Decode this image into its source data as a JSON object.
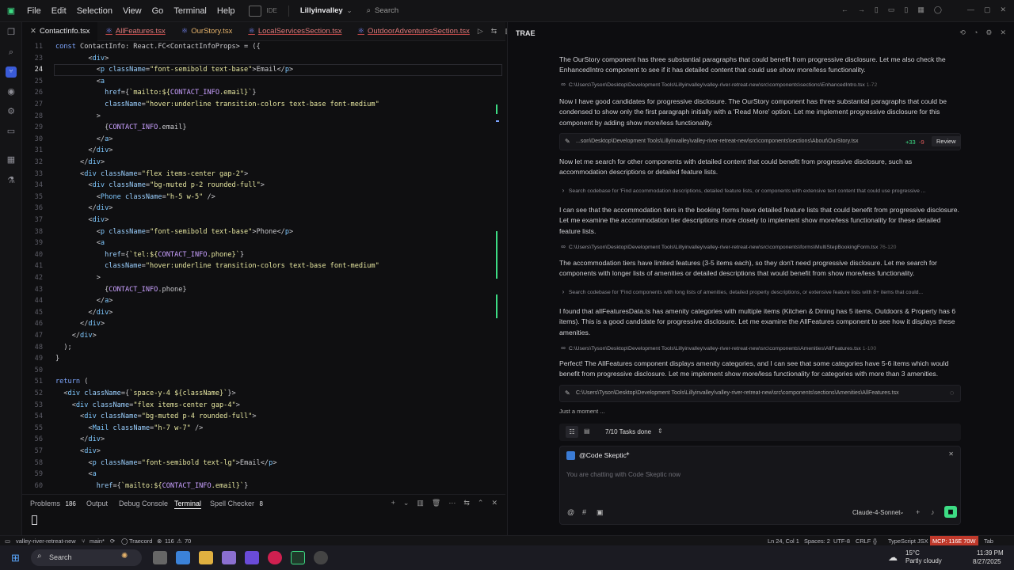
{
  "menu": [
    "File",
    "Edit",
    "Selection",
    "View",
    "Go",
    "Terminal",
    "Help"
  ],
  "ide_badge": "IDE",
  "project": "Lillyinvalley",
  "search_placeholder": "Search",
  "tabs": [
    {
      "label": "ContactInfo.tsx",
      "active": true
    },
    {
      "label": "AllFeatures.tsx",
      "active": false
    },
    {
      "label": "OurStory.tsx",
      "active": false
    },
    {
      "label": "LocalServicesSection.tsx",
      "active": false
    },
    {
      "label": "OutdoorAdventuresSection.tsx",
      "active": false
    }
  ],
  "code": [
    {
      "n": "11",
      "t": "const ContactInfo: React.FC<ContactInfoProps> = ({"
    },
    {
      "n": "23",
      "t": "        <div>"
    },
    {
      "n": "24",
      "t": "          <p className=\"font-semibold text-base\">Email</p>"
    },
    {
      "n": "25",
      "t": "          <a"
    },
    {
      "n": "26",
      "t": "            href={`mailto:${CONTACT_INFO.email}`}"
    },
    {
      "n": "27",
      "t": "            className=\"hover:underline transition-colors text-base font-medium\""
    },
    {
      "n": "28",
      "t": "          >"
    },
    {
      "n": "29",
      "t": "            {CONTACT_INFO.email}"
    },
    {
      "n": "30",
      "t": "          </a>"
    },
    {
      "n": "31",
      "t": "        </div>"
    },
    {
      "n": "32",
      "t": "      </div>"
    },
    {
      "n": "33",
      "t": "      <div className=\"flex items-center gap-2\">"
    },
    {
      "n": "34",
      "t": "        <div className=\"bg-muted p-2 rounded-full\">"
    },
    {
      "n": "35",
      "t": "          <Phone className=\"h-5 w-5\" />"
    },
    {
      "n": "36",
      "t": "        </div>"
    },
    {
      "n": "37",
      "t": "        <div>"
    },
    {
      "n": "38",
      "t": "          <p className=\"font-semibold text-base\">Phone</p>"
    },
    {
      "n": "39",
      "t": "          <a"
    },
    {
      "n": "40",
      "t": "            href={`tel:${CONTACT_INFO.phone}`}"
    },
    {
      "n": "41",
      "t": "            className=\"hover:underline transition-colors text-base font-medium\""
    },
    {
      "n": "42",
      "t": "          >"
    },
    {
      "n": "43",
      "t": "            {CONTACT_INFO.phone}"
    },
    {
      "n": "44",
      "t": "          </a>"
    },
    {
      "n": "45",
      "t": "        </div>"
    },
    {
      "n": "46",
      "t": "      </div>"
    },
    {
      "n": "47",
      "t": "    </div>"
    },
    {
      "n": "48",
      "t": "  );"
    },
    {
      "n": "49",
      "t": "}"
    },
    {
      "n": "50",
      "t": ""
    },
    {
      "n": "51",
      "t": "return ("
    },
    {
      "n": "52",
      "t": "  <div className={`space-y-4 ${className}`}>"
    },
    {
      "n": "53",
      "t": "    <div className=\"flex items-center gap-4\">"
    },
    {
      "n": "54",
      "t": "      <div className=\"bg-muted p-4 rounded-full\">"
    },
    {
      "n": "55",
      "t": "        <Mail className=\"h-7 w-7\" />"
    },
    {
      "n": "56",
      "t": "      </div>"
    },
    {
      "n": "57",
      "t": "      <div>"
    },
    {
      "n": "58",
      "t": "        <p className=\"font-semibold text-lg\">Email</p>"
    },
    {
      "n": "59",
      "t": "        <a"
    },
    {
      "n": "60",
      "t": "          href={`mailto:${CONTACT_INFO.email}`}"
    }
  ],
  "panel": {
    "problems": "Problems",
    "problems_count": "186",
    "output": "Output",
    "debug": "Debug Console",
    "terminal": "Terminal",
    "spell": "Spell Checker",
    "spell_count": "8"
  },
  "status": {
    "repo": "valley-river-retreat-new",
    "branch": "main*",
    "trae": "Traecord",
    "errors": "116",
    "warnings": "70",
    "pos": "Ln 24, Col 1",
    "spaces": "Spaces: 2",
    "enc": "UTF-8",
    "eol": "CRLF",
    "lang": "TypeScript JSX",
    "mcp": "MCP: 116E 70W",
    "tab": "Tab"
  },
  "taskbar": {
    "search": "Search",
    "temp": "15°C",
    "weather": "Partly cloudy",
    "time": "11:39 PM",
    "date": "8/27/2025"
  },
  "chat": {
    "title": "TRAE",
    "p1": "The OurStory component has three substantial paragraphs that could benefit from progressive disclosure. Let me also check the EnhancedIntro component to see if it has detailed content that could use show more/less functionality.",
    "ref1": "C:\\Users\\Tyson\\Desktop\\Development Tools\\Lillyinvalley\\valley-river-retreat-new\\src\\components\\sections\\EnhancedIntro.tsx",
    "ref1_lines": "1-72",
    "p2": "Now I have good candidates for progressive disclosure. The OurStory component has three substantial paragraphs that could be condensed to show only the first paragraph initially with a 'Read More' option. Let me implement progressive disclosure for this component by adding show more/less functionality.",
    "card1": "...son\\Desktop\\Development Tools\\Lillyinvalley\\valley-river-retreat-new\\src\\components\\sections\\About\\OurStory.tsx",
    "card1_add": "+33",
    "card1_del": "-9",
    "card1_btn": "Review",
    "p3": "Now let me search for other components with detailed content that could benefit from progressive disclosure, such as accommodation descriptions or detailed feature lists.",
    "search1": "Search codebase for 'Find accommodation descriptions, detailed feature lists, or components with extensive text content that could use progressive ...",
    "p4": "I can see that the accommodation tiers in the booking forms have detailed feature lists that could benefit from progressive disclosure. Let me examine the accommodation tier descriptions more closely to implement show more/less functionality for these detailed feature lists.",
    "ref2": "C:\\Users\\Tyson\\Desktop\\Development Tools\\Lillyinvalley\\valley-river-retreat-new\\src\\components\\forms\\MultiStepBookingForm.tsx",
    "ref2_lines": "76-120",
    "p5": "The accommodation tiers have limited features (3-5 items each), so they don't need progressive disclosure. Let me search for components with longer lists of amenities or detailed descriptions that would benefit from show more/less functionality.",
    "search2": "Search codebase for 'Find components with long lists of amenities, detailed property descriptions, or extensive feature lists with 8+ items that could...",
    "p6": "I found that allFeaturesData.ts has amenity categories with multiple items (Kitchen & Dining has 5 items, Outdoors & Property has 6 items). This is a good candidate for progressive disclosure. Let me examine the AllFeatures component to see how it displays these amenities.",
    "ref3": "C:\\Users\\Tyson\\Desktop\\Development Tools\\Lillyinvalley\\valley-river-retreat-new\\src\\components\\Amenities\\AllFeatures.tsx",
    "ref3_lines": "1-100",
    "p7": "Perfect! The AllFeatures component displays amenity categories, and I can see that some categories have 5-6 items which would benefit from progressive disclosure. Let me implement show more/less functionality for categories with more than 3 amenities.",
    "card2": "C:\\Users\\Tyson\\Desktop\\Development Tools\\Lillyinvalley\\valley-river-retreat-new\\src\\components\\sections\\Amenities\\AllFeatures.tsx",
    "moment": "Just a moment ...",
    "tasks": "7/10 Tasks done",
    "agent": "@Code Skeptic",
    "input_placeholder": "You are chatting with Code Skeptic now",
    "model": "Claude-4-Sonnet"
  },
  "colors": {
    "accent": "#3ddc84",
    "add": "#3ddc84",
    "del": "#e05a5a",
    "mcp_bg": "#c0392b"
  }
}
